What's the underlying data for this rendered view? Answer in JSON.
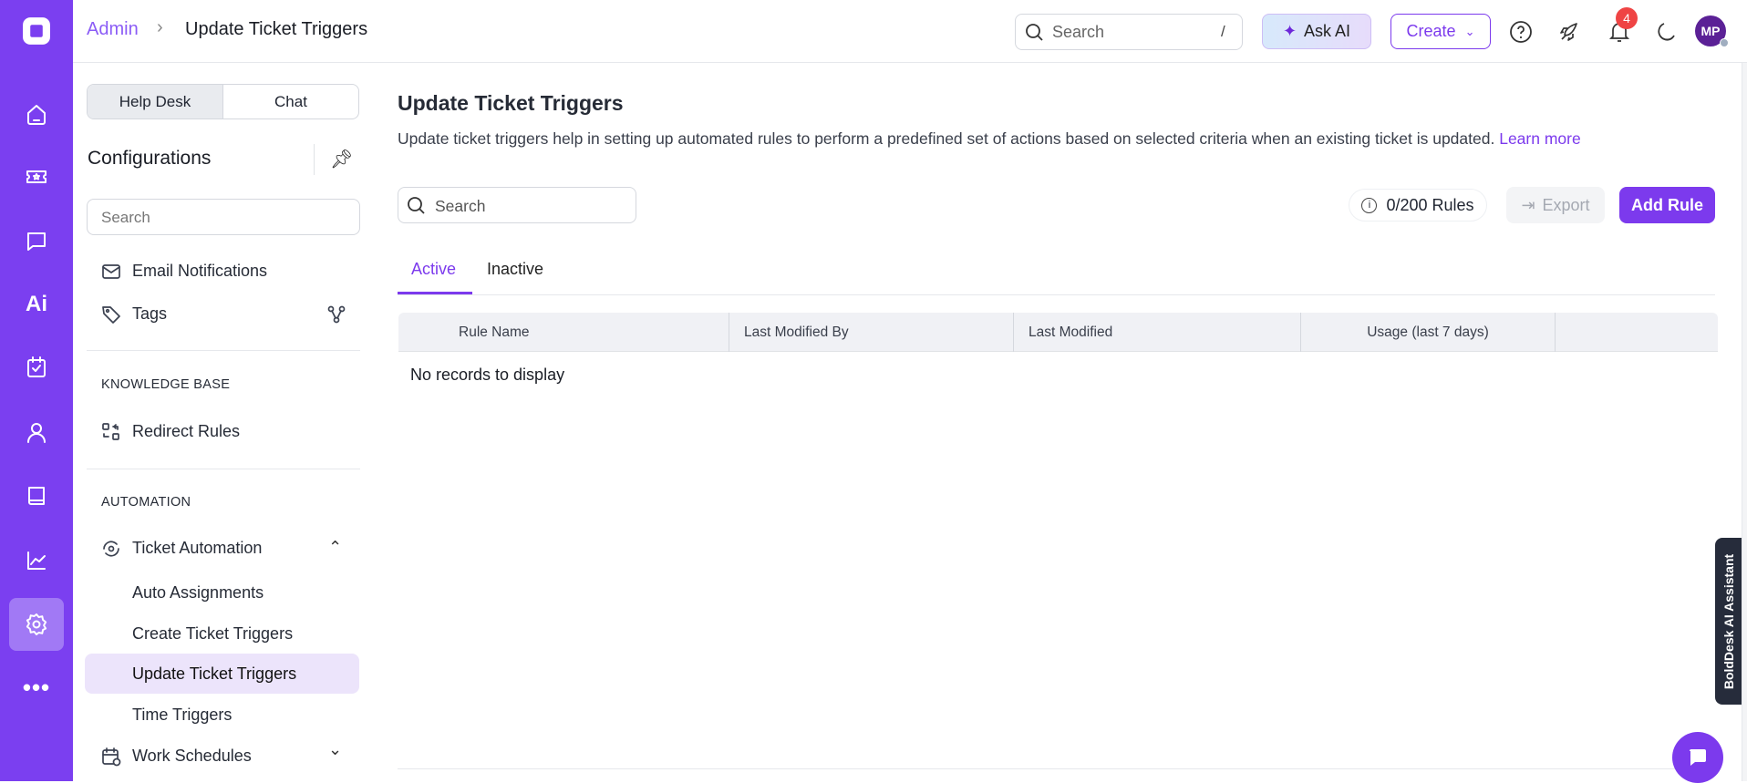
{
  "header": {
    "breadcrumb_root": "Admin",
    "breadcrumb_current": "Update Ticket Triggers",
    "search_placeholder": "Search",
    "search_shortcut": "/",
    "ask_ai": "Ask AI",
    "create": "Create",
    "notifications_count": "4",
    "avatar_initials": "MP"
  },
  "rail": {
    "items": [
      "home-icon",
      "ticket-icon",
      "chat-icon",
      "ai-icon",
      "tasks-icon",
      "contacts-icon",
      "knowledge-icon",
      "reports-icon",
      "settings-icon",
      "more-icon"
    ],
    "ai_label": "Ai",
    "active": "settings"
  },
  "sidebar": {
    "tabs": [
      "Help Desk",
      "Chat"
    ],
    "title": "Configurations",
    "search_placeholder": "Search",
    "items": {
      "email": "Email Notifications",
      "tags": "Tags",
      "kb_section": "KNOWLEDGE BASE",
      "redirect": "Redirect Rules",
      "automation_section": "AUTOMATION",
      "ticket_automation": "Ticket Automation",
      "auto_assign": "Auto Assignments",
      "create_triggers": "Create Ticket Triggers",
      "update_triggers": "Update Ticket Triggers",
      "time_triggers": "Time Triggers",
      "work_schedules": "Work Schedules"
    }
  },
  "main": {
    "title": "Update Ticket Triggers",
    "description": "Update ticket triggers help in setting up automated rules to perform a predefined set of actions based on selected criteria when an existing ticket is updated.",
    "learn_more": "Learn more",
    "search_placeholder": "Search",
    "rules_count": "0/200 Rules",
    "export": "Export",
    "add_rule": "Add Rule",
    "tabs": [
      "Active",
      "Inactive"
    ],
    "columns": [
      "Rule Name",
      "Last Modified By",
      "Last Modified",
      "Usage (last 7 days)"
    ],
    "empty": "No records to display"
  },
  "assistant": {
    "label": "BoldDesk AI Assistant"
  },
  "colors": {
    "brand": "#7b3ff0",
    "accent": "#7c3aed",
    "badge": "#ef4444"
  }
}
